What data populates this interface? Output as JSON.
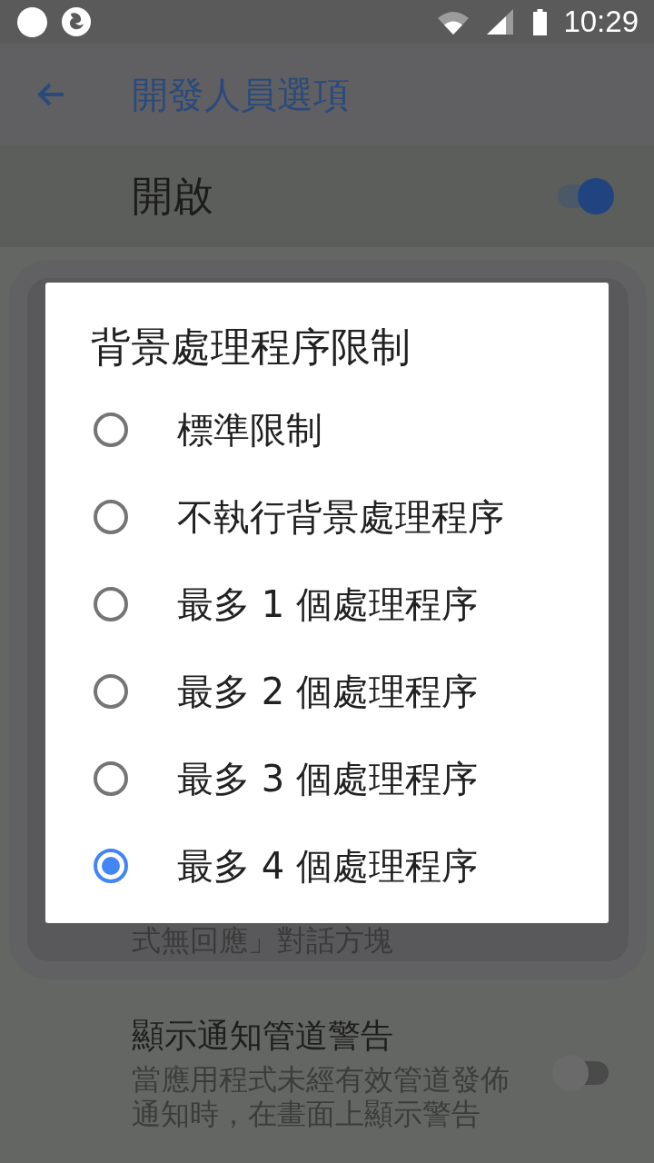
{
  "status_bar": {
    "time": "10:29"
  },
  "app_bar": {
    "title": "開發人員選項"
  },
  "main_switch": {
    "label": "開啟",
    "on": true
  },
  "settings": [
    {
      "kind": "summary",
      "summary": "式無回應」對話方塊"
    },
    {
      "kind": "switch",
      "title": "顯示通知管道警告",
      "summary": "當應用程式未經有效管道發佈通知時，在畫面上顯示警告",
      "on": false
    }
  ],
  "dialog": {
    "title": "背景處理程序限制",
    "options": [
      {
        "label": "標準限制",
        "selected": false
      },
      {
        "label": "不執行背景處理程序",
        "selected": false
      },
      {
        "label": "最多 1 個處理程序",
        "selected": false
      },
      {
        "label": "最多 2 個處理程序",
        "selected": false
      },
      {
        "label": "最多 3 個處理程序",
        "selected": false
      },
      {
        "label": "最多 4 個處理程序",
        "selected": true
      }
    ]
  }
}
